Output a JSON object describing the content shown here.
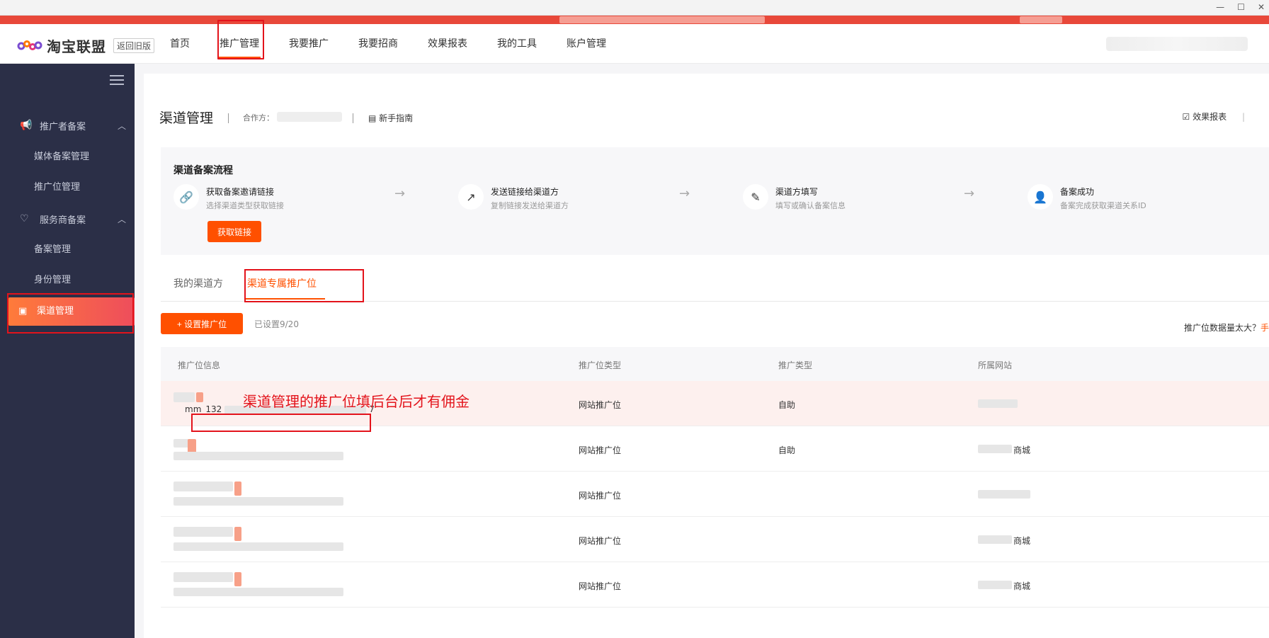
{
  "nav": {
    "brand": "淘宝联盟",
    "return_old": "返回旧版",
    "items": [
      "首页",
      "推广管理",
      "我要推广",
      "我要招商",
      "效果报表",
      "我的工具",
      "账户管理"
    ]
  },
  "sidebar": {
    "group1": "推广者备案",
    "group1_items": [
      "媒体备案管理",
      "推广位管理"
    ],
    "group2": "服务商备案",
    "group2_items": [
      "备案管理",
      "身份管理"
    ],
    "active": "渠道管理"
  },
  "header": {
    "title": "渠道管理",
    "partner_label": "合作方：",
    "guide": "新手指南",
    "report": "效果报表"
  },
  "flow": {
    "title": "渠道备案流程",
    "steps": [
      {
        "title": "获取备案邀请链接",
        "desc": "选择渠道类型获取链接"
      },
      {
        "title": "发送链接给渠道方",
        "desc": "复制链接发送给渠道方"
      },
      {
        "title": "渠道方填写",
        "desc": "填写或确认备案信息"
      },
      {
        "title": "备案成功",
        "desc": "备案完成获取渠道关系ID"
      }
    ],
    "button": "获取链接"
  },
  "tabs": [
    "我的渠道方",
    "渠道专属推广位"
  ],
  "toolbar": {
    "set_button": "+ 设置推广位",
    "count": "已设置9/20",
    "data_tip": "推广位数据量太大？",
    "data_tip_link": "手"
  },
  "table": {
    "headers": [
      "推广位信息",
      "推广位类型",
      "推广类型",
      "所属网站"
    ],
    "rows": [
      {
        "info": "mm_132",
        "info_tail": "7",
        "type": "网站推广位",
        "promo": "自助",
        "site": ""
      },
      {
        "info": "",
        "type": "网站推广位",
        "promo": "自助",
        "site": "商城"
      },
      {
        "info": "",
        "type": "网站推广位",
        "promo": "",
        "site": ""
      },
      {
        "info": "",
        "type": "网站推广位",
        "promo": "",
        "site": "商城"
      },
      {
        "info": "",
        "type": "网站推广位",
        "promo": "",
        "site": "商城"
      }
    ]
  },
  "annotation": "渠道管理的推广位填后台后才有佣金",
  "colors": {
    "accent": "#ff5000",
    "sidebar": "#2b2f47",
    "annotation_red": "#e3131b"
  }
}
